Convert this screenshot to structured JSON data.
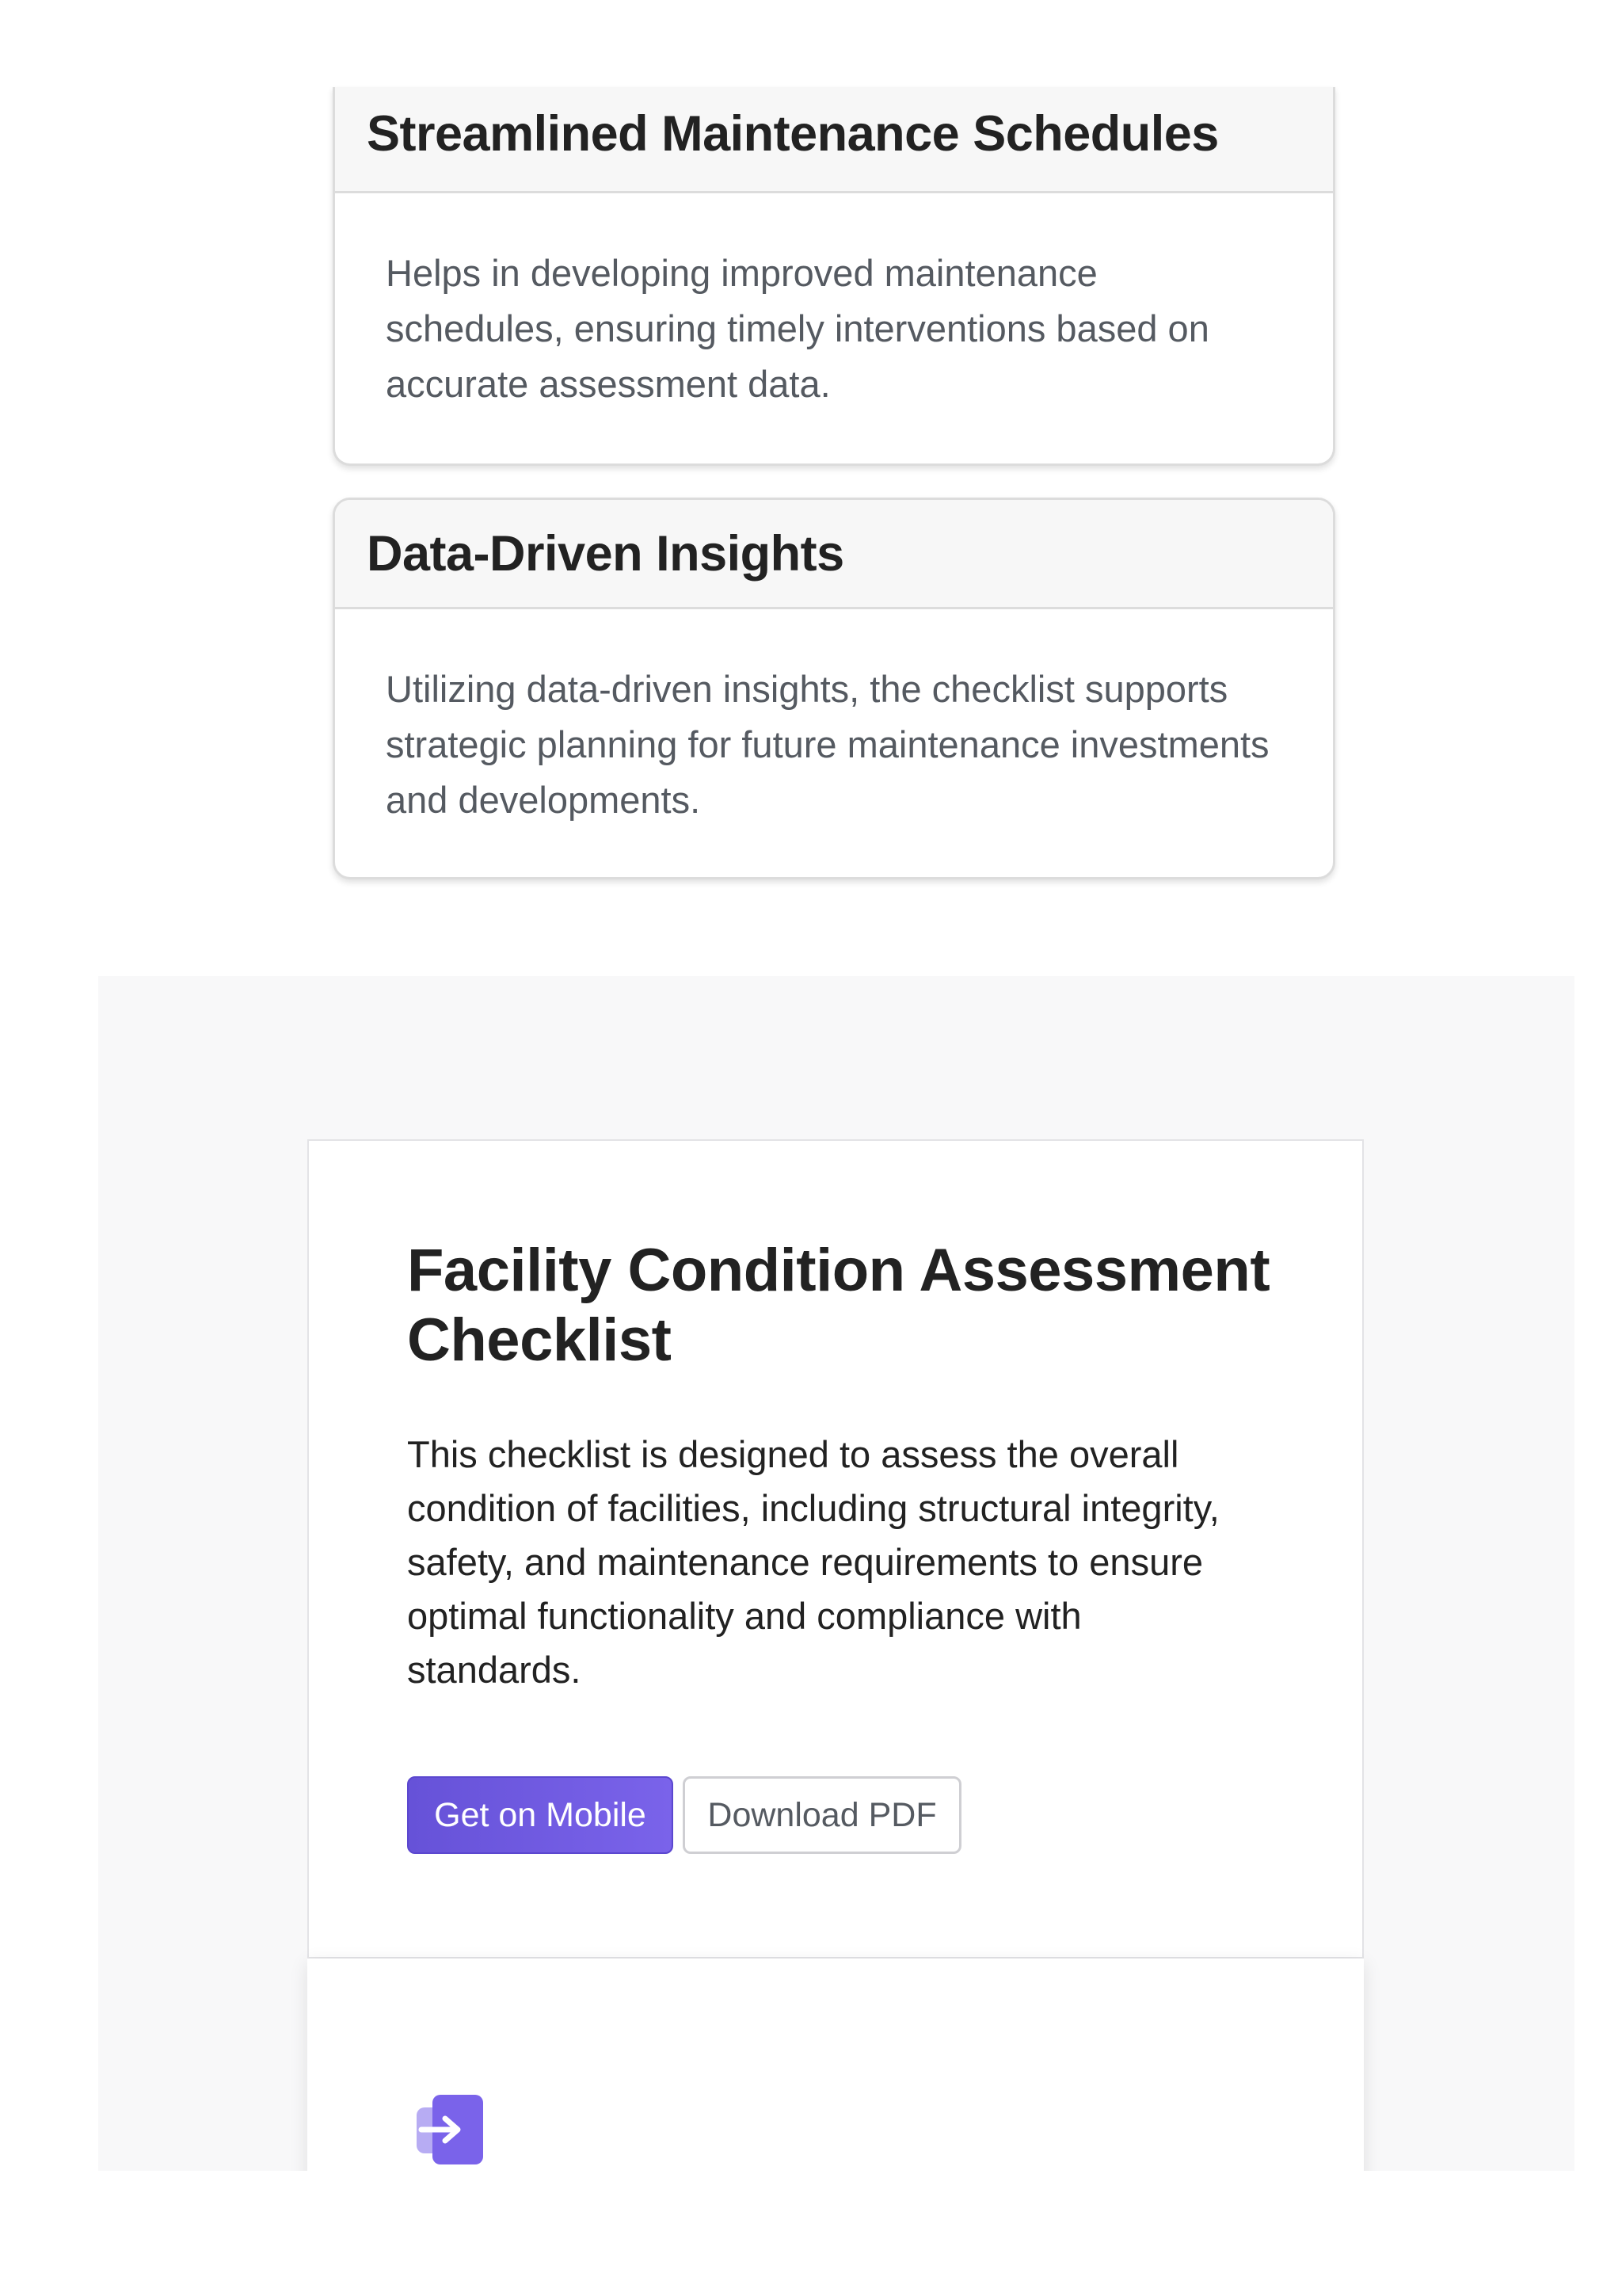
{
  "features": [
    {
      "title": "Streamlined Maintenance Schedules",
      "body": "Helps in developing improved maintenance schedules, ensuring timely interventions based on accurate assessment data."
    },
    {
      "title": "Data-Driven Insights",
      "body": "Utilizing data-driven insights, the checklist supports strategic planning for future maintenance investments and developments."
    }
  ],
  "cta": {
    "title": "Facility Condition Assessment Checklist",
    "description": "This checklist is designed to assess the overall condition of facilities, including structural integrity, safety, and maintenance requirements to ensure optimal functionality and compliance with standards.",
    "primary_button": "Get on Mobile",
    "secondary_button": "Download PDF"
  },
  "icons": {
    "app_icon": "arrow-right-app-icon"
  },
  "colors": {
    "accent": "#6652d8",
    "accent_light": "#a89cf0",
    "section_bg": "#f8f8f9"
  }
}
